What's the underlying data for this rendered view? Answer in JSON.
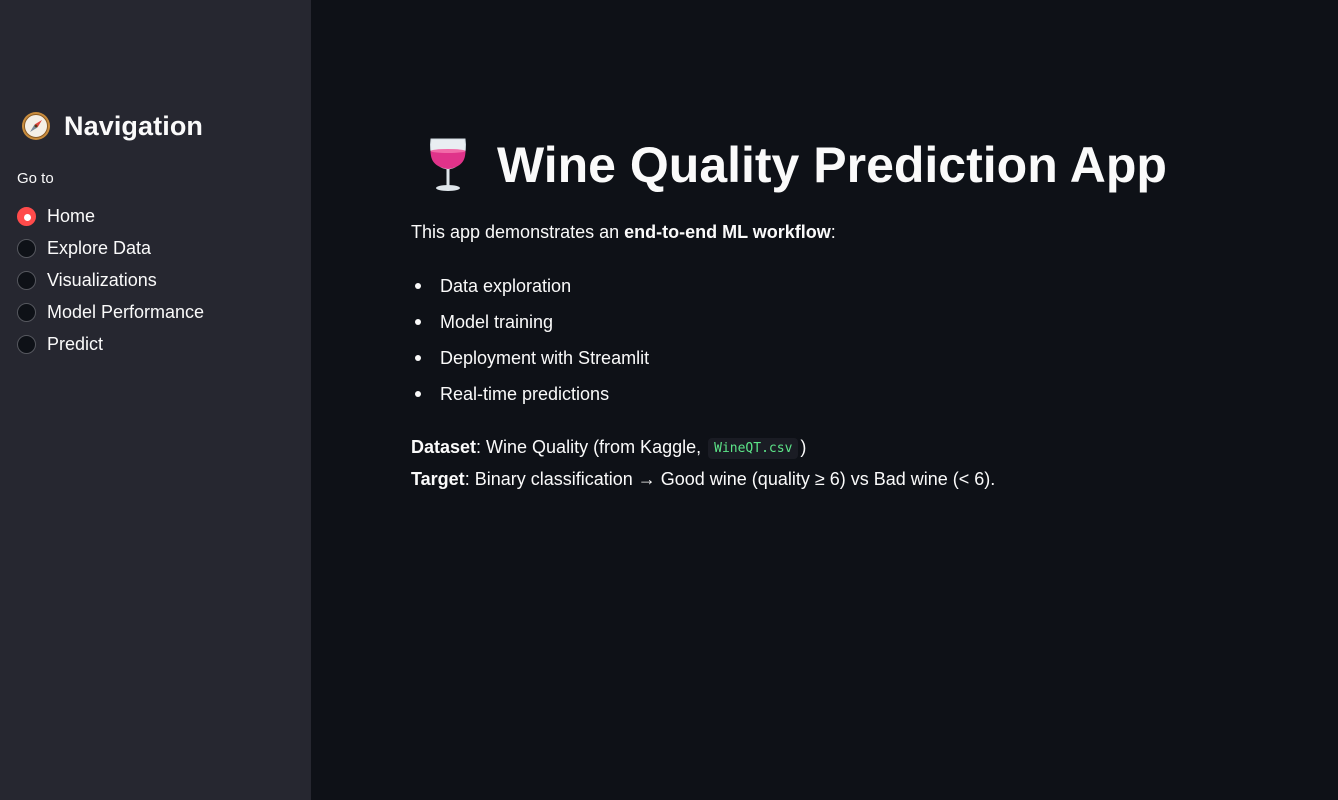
{
  "sidebar": {
    "title": "Navigation",
    "title_icon": "compass-icon",
    "radio_label": "Go to",
    "options": [
      "Home",
      "Explore Data",
      "Visualizations",
      "Model Performance",
      "Predict"
    ],
    "selected": "Home"
  },
  "main": {
    "title": "Wine Quality Prediction App",
    "title_icon": "wine-glass-icon",
    "intro_prefix": "This app demonstrates an ",
    "intro_bold": "end-to-end ML workflow",
    "intro_suffix": ":",
    "bullets": [
      "Data exploration",
      "Model training",
      "Deployment with Streamlit",
      "Real-time predictions"
    ],
    "dataset_label": "Dataset",
    "dataset_text": ": Wine Quality (from Kaggle, ",
    "dataset_file": "WineQT.csv",
    "dataset_end": ")",
    "target_label": "Target",
    "target_text": ": Binary classification → Good wine (quality ≥ 6) vs Bad wine (< 6)."
  },
  "colors": {
    "background": "#0e1117",
    "sidebar": "#262730",
    "accent": "#ff4b4b",
    "code_text": "#5ce488"
  }
}
